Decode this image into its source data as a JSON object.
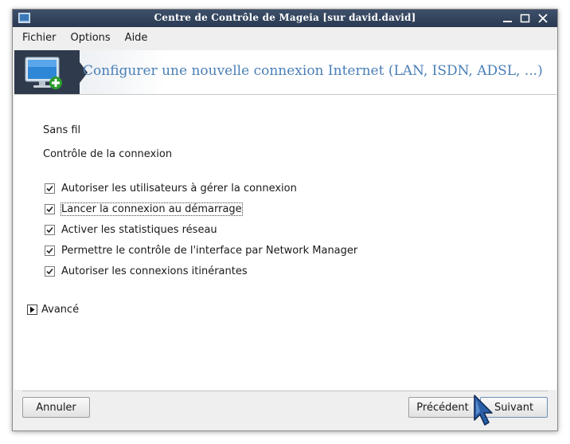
{
  "window": {
    "title": "Centre de Contrôle de Mageia  [sur david.david]"
  },
  "menubar": {
    "items": [
      "Fichier",
      "Options",
      "Aide"
    ]
  },
  "banner": {
    "title": "Configurer une nouvelle connexion Internet (LAN, ISDN, ADSL, ...)",
    "icon": "monitor-add-icon"
  },
  "content": {
    "section_label": "Sans fil",
    "subsection_label": "Contrôle de la connexion",
    "options": [
      {
        "label": "Autoriser les utilisateurs à gérer la connexion",
        "checked": true
      },
      {
        "label": "Lancer la connexion au démarrage",
        "checked": true
      },
      {
        "label": "Activer les statistiques réseau",
        "checked": true
      },
      {
        "label": "Permettre le contrôle de l'interface par Network Manager",
        "checked": true
      },
      {
        "label": "Autoriser les connexions itinérantes",
        "checked": true
      }
    ],
    "advanced_label": "Avancé"
  },
  "buttons": {
    "cancel": "Annuler",
    "previous": "Précédent",
    "next": "Suivant"
  },
  "colors": {
    "titlebar": "#2b3a52",
    "banner_title": "#4a7fb6",
    "banner_icon_bg": "#2f3b4c",
    "window_bg": "#efefef"
  }
}
